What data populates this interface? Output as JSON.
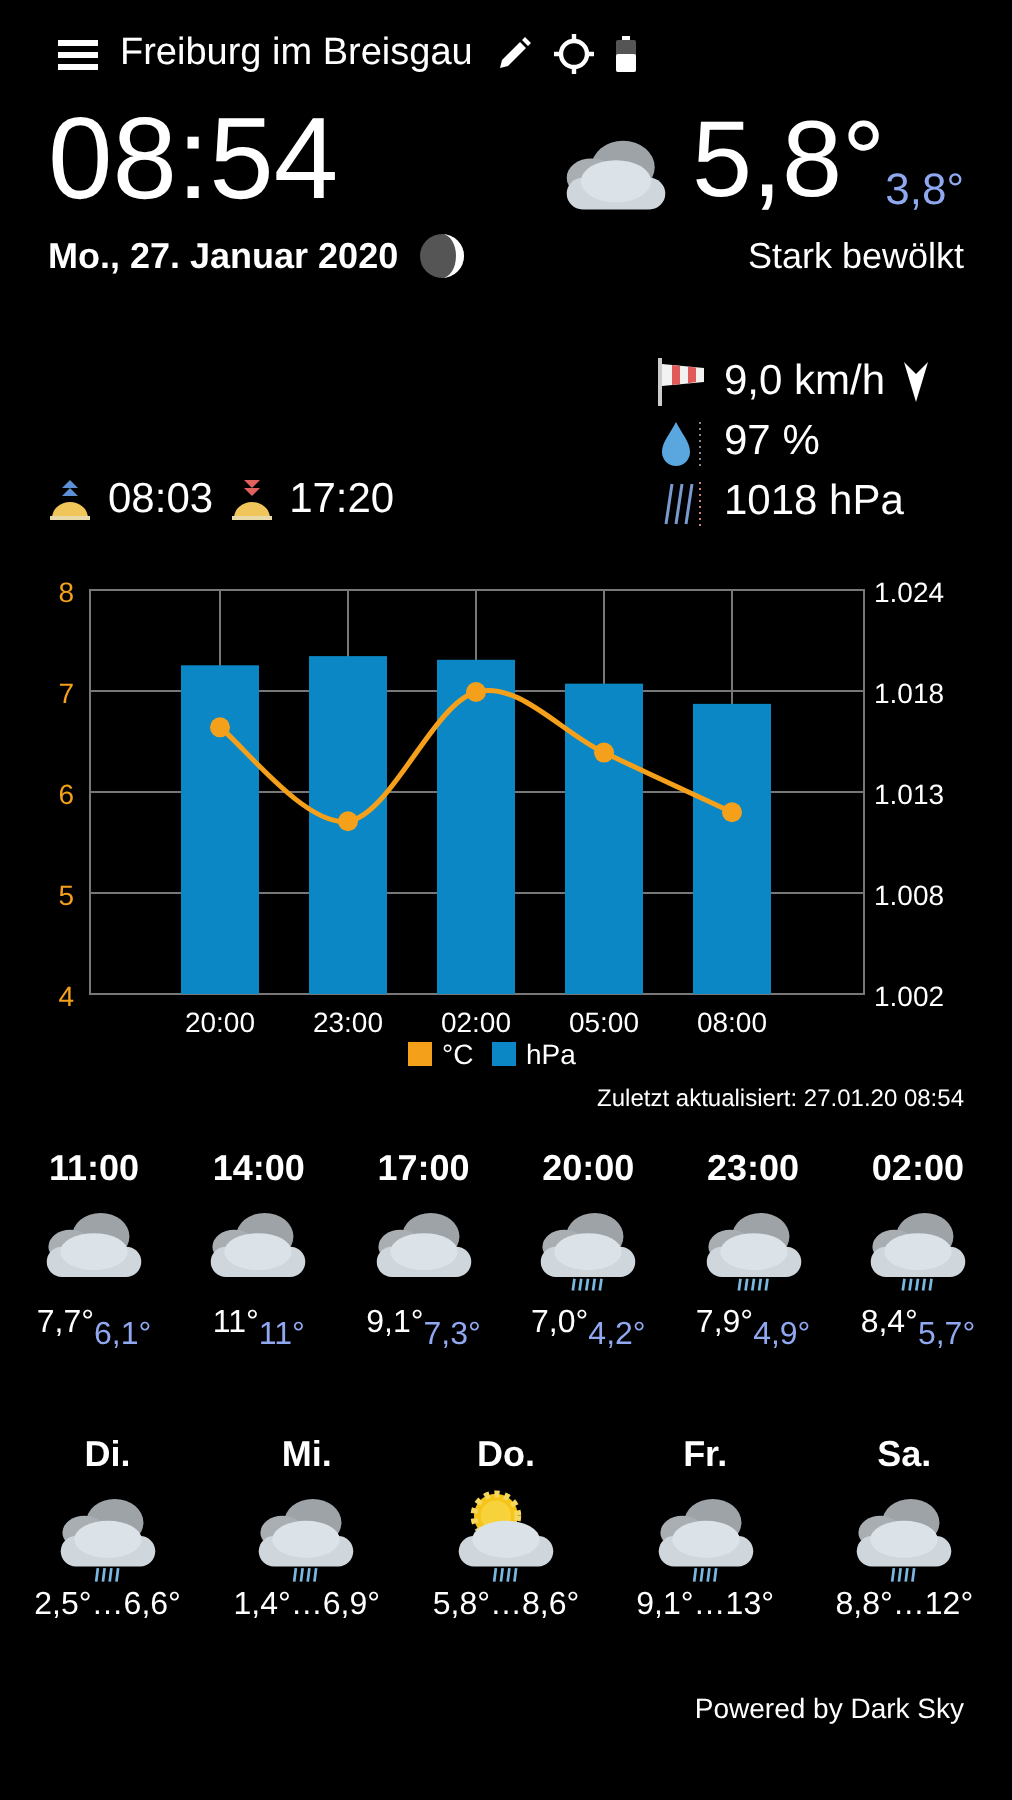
{
  "header": {
    "location": "Freiburg im Breisgau"
  },
  "now": {
    "time": "08:54",
    "date": "Mo., 27. Januar 2020",
    "temperature": "5,8°",
    "feels_like": "3,8°",
    "condition": "Stark bewölkt",
    "kind": "cloudy"
  },
  "sun": {
    "sunrise": "08:03",
    "sunset": "17:20"
  },
  "details": {
    "wind": "9,0 km/h",
    "humidity": "97 %",
    "pressure": "1018 hPa"
  },
  "chart": {
    "chart_data": {
      "type": "bar",
      "categories": [
        "20:00",
        "23:00",
        "02:00",
        "05:00",
        "08:00"
      ],
      "series": [
        {
          "name": "°C",
          "type": "line",
          "marker": "circle",
          "color": "#f5a01a",
          "values": [
            6.64,
            5.71,
            6.99,
            6.39,
            5.8
          ]
        },
        {
          "name": "hPa",
          "type": "bar",
          "axis": "y2",
          "color": "#0a87c4",
          "values": [
            1019.9,
            1020.4,
            1020.2,
            1018.9,
            1017.8
          ]
        }
      ],
      "grid": true,
      "legend": true,
      "ylim": [
        4,
        8
      ],
      "yticks": [
        4,
        5,
        6,
        7,
        8
      ],
      "y2lim": [
        1002,
        1024
      ],
      "y2ticks": [
        {
          "value": 1002,
          "label": "1.002"
        },
        {
          "value": 1007.5,
          "label": "1.008"
        },
        {
          "value": 1013,
          "label": "1.013"
        },
        {
          "value": 1018.5,
          "label": "1.018"
        },
        {
          "value": 1024,
          "label": "1.024"
        }
      ]
    },
    "updated": "Zuletzt aktualisiert: 27.01.20 08:54"
  },
  "hourly": [
    {
      "time": "11:00",
      "kind": "cloudy",
      "temp": "7,7°",
      "feels": "6,1°"
    },
    {
      "time": "14:00",
      "kind": "cloudy",
      "temp": "11°",
      "feels": "11°"
    },
    {
      "time": "17:00",
      "kind": "cloudy",
      "temp": "9,1°",
      "feels": "7,3°"
    },
    {
      "time": "20:00",
      "kind": "rain",
      "temp": "7,0°",
      "feels": "4,2°"
    },
    {
      "time": "23:00",
      "kind": "rain",
      "temp": "7,9°",
      "feels": "4,9°"
    },
    {
      "time": "02:00",
      "kind": "rain",
      "temp": "8,4°",
      "feels": "5,7°"
    }
  ],
  "daily": [
    {
      "day": "Di.",
      "kind": "rain",
      "range": "2,5°…6,6°"
    },
    {
      "day": "Mi.",
      "kind": "rain",
      "range": "1,4°…6,9°"
    },
    {
      "day": "Do.",
      "kind": "sun-rain",
      "range": "5,8°…8,6°"
    },
    {
      "day": "Fr.",
      "kind": "rain",
      "range": "9,1°…13°"
    },
    {
      "day": "Sa.",
      "kind": "rain",
      "range": "8,8°…12°"
    }
  ],
  "footer": "Powered by Dark Sky"
}
